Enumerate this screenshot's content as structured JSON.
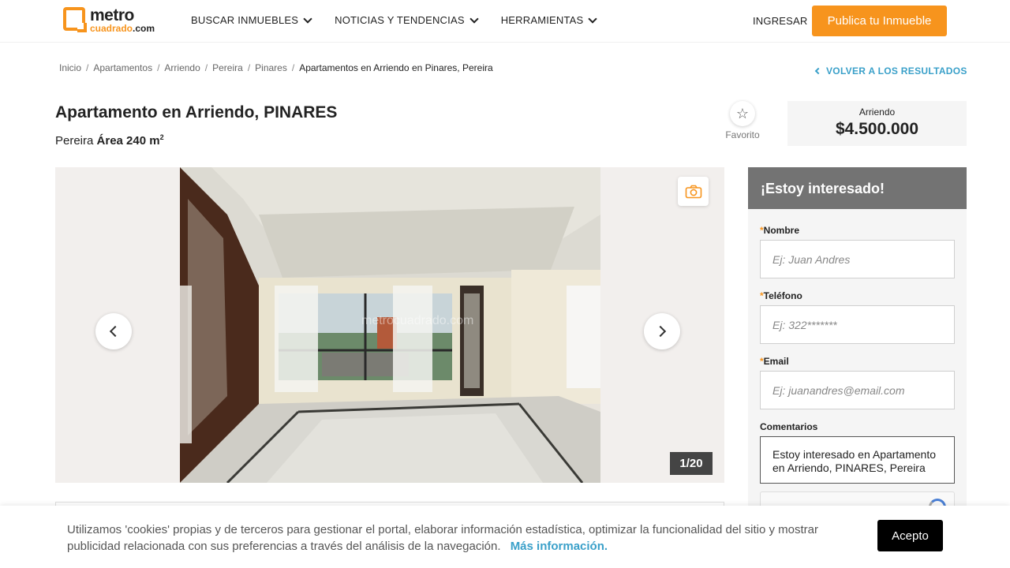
{
  "header": {
    "logo_main": "metro",
    "logo_sub": "cuadrado",
    "logo_tld": ".com",
    "nav": [
      {
        "label": "BUSCAR INMUEBLES"
      },
      {
        "label": "NOTICIAS Y TENDENCIAS"
      },
      {
        "label": "HERRAMIENTAS"
      }
    ],
    "login_label": "INGRESAR",
    "publish_label": "Publica tu Inmueble"
  },
  "breadcrumb": {
    "items": [
      "Inicio",
      "Apartamentos",
      "Arriendo",
      "Pereira",
      "Pinares"
    ],
    "current": "Apartamentos en Arriendo en Pinares, Pereira",
    "separator": "/"
  },
  "back_link": "VOLVER A LOS RESULTADOS",
  "listing": {
    "title": "Apartamento en Arriendo, PINARES",
    "city": "Pereira",
    "area_label": "Área 240 m",
    "area_unit_sup": "2",
    "favorite_label": "Favorito",
    "price_label": "Arriendo",
    "price_value": "$4.500.000"
  },
  "gallery": {
    "counter": "1/20",
    "watermark": "metrocuadrado.com",
    "icons": {
      "prev": "chevron-left-icon",
      "next": "chevron-right-icon",
      "camera": "camera-icon"
    }
  },
  "form": {
    "title": "¡Estoy interesado!",
    "fields": {
      "name_label": "Nombre",
      "name_placeholder": "Ej: Juan Andres",
      "phone_label": "Teléfono",
      "phone_placeholder": "Ej: 322*******",
      "email_label": "Email",
      "email_placeholder": "Ej: juanandres@email.com",
      "comments_label": "Comentarios",
      "comments_value": "Estoy interesado en Apartamento en Arriendo, PINARES, Pereira"
    },
    "required_mark": "*"
  },
  "cookie": {
    "text": "Utilizamos 'cookies' propias y de terceros para gestionar el portal, elaborar información estadística, optimizar la funcionalidad del sitio y mostrar publicidad relacionada con sus preferencias a través del análisis de la navegación.",
    "link": "Más información.",
    "accept_label": "Acepto"
  },
  "colors": {
    "brand_orange": "#f7941d",
    "link_blue": "#3aa0c9",
    "form_header": "#737373"
  }
}
